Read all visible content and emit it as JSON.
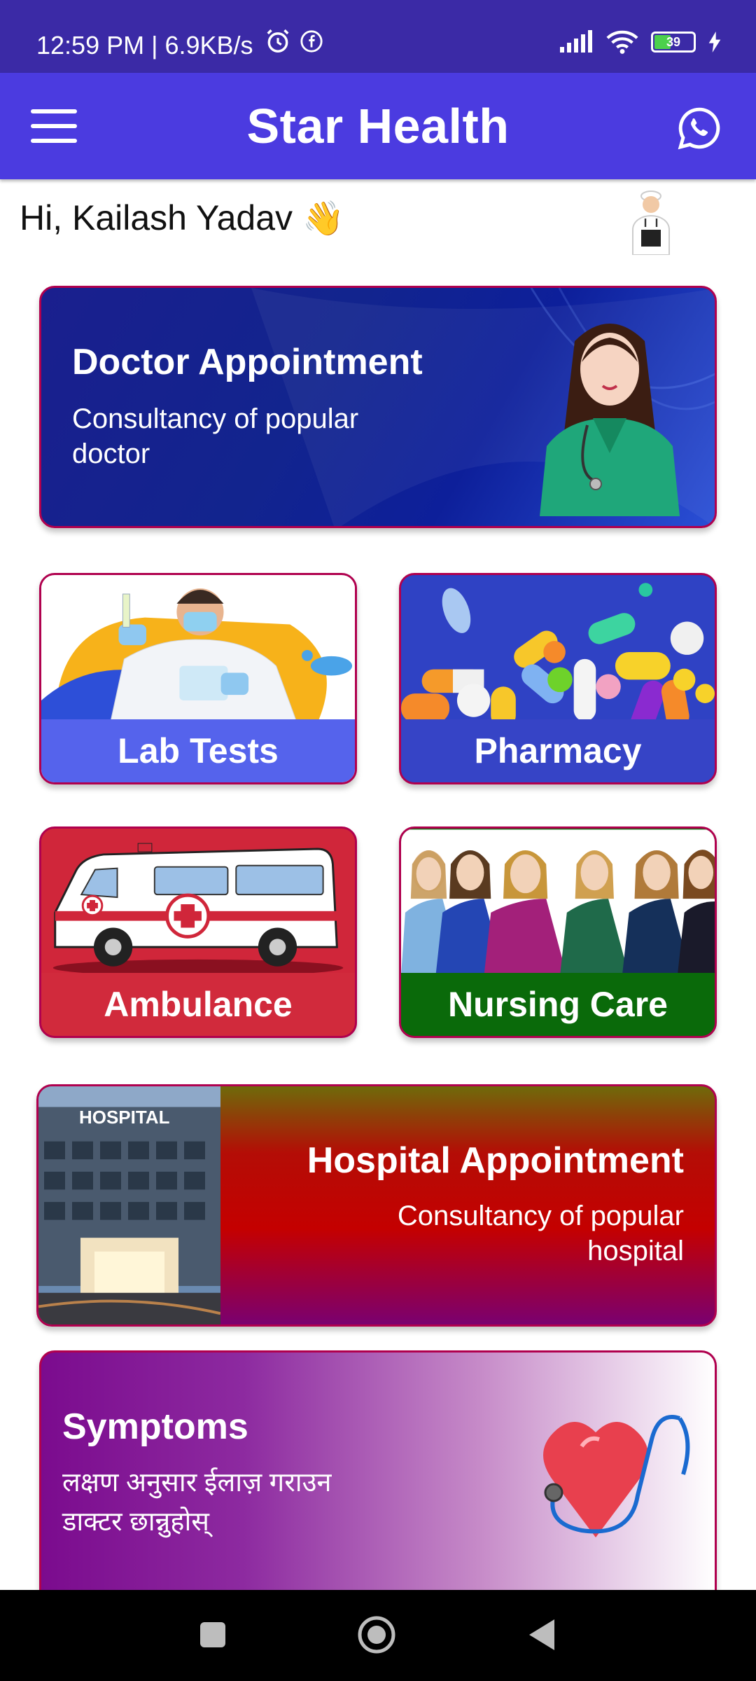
{
  "status_bar": {
    "time": "12:59 PM | 6.9KB/s",
    "battery": "39"
  },
  "app_bar": {
    "title": "Star Health"
  },
  "greeting": {
    "text": "Hi, Kailash Yadav",
    "emoji": "👋"
  },
  "doctor_card": {
    "title": "Doctor Appointment",
    "subtitle": "Consultancy of popular doctor"
  },
  "tiles": {
    "lab": "Lab Tests",
    "pharmacy": "Pharmacy",
    "ambulance": "Ambulance",
    "nursing": "Nursing Care"
  },
  "hospital_card": {
    "title": "Hospital Appointment",
    "subtitle": "Consultancy of popular hospital",
    "sign": "HOSPITAL"
  },
  "symptoms_card": {
    "title": "Symptoms",
    "line1": "लक्षण अनुसार ईलाज़ गराउन",
    "line2": "डाक्टर छान्नुहोस्"
  },
  "colors": {
    "status_bar": "#3b2aa6",
    "app_bar": "#4b3be0",
    "card_border": "#b0004e"
  },
  "icons": [
    "alarm-icon",
    "facebook-icon",
    "signal-icon",
    "wifi-icon",
    "battery-icon",
    "charging-icon",
    "menu-icon",
    "whatsapp-icon",
    "waving-hand-emoji",
    "doctor-avatar",
    "nav-recent-icon",
    "nav-home-icon",
    "nav-back-icon"
  ]
}
